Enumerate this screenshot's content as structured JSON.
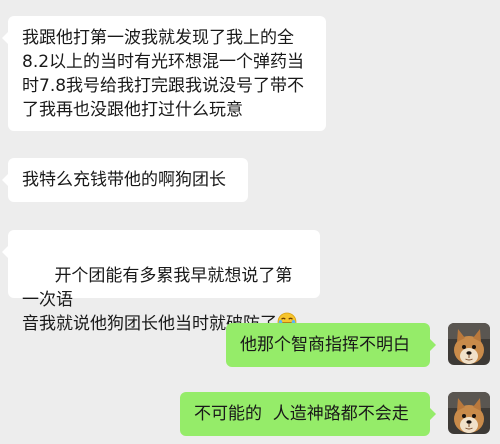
{
  "messages": [
    {
      "side": "left",
      "text": "我跟他打第一波我就发现了我上的全\n8.2以上的当时有光环想混一个弹药当\n时7.8我号给我打完跟我说没号了带不\n了我再也没跟他打过什么玩意"
    },
    {
      "side": "left",
      "text": "我特么充钱带他的啊狗团长"
    },
    {
      "side": "left",
      "text": "开个团能有多累我早就想说了第一次语\n音我就说他狗团长他当时就破防了",
      "emoji": "laughing-tears-emoji"
    },
    {
      "side": "right",
      "text": "他那个智商指挥不明白",
      "avatar": "dog-avatar"
    },
    {
      "side": "right",
      "text": "不可能的  人造神路都不会走",
      "avatar": "dog-avatar"
    }
  ],
  "colors": {
    "background": "#ededed",
    "incoming_bubble": "#ffffff",
    "outgoing_bubble": "#95ec69"
  }
}
